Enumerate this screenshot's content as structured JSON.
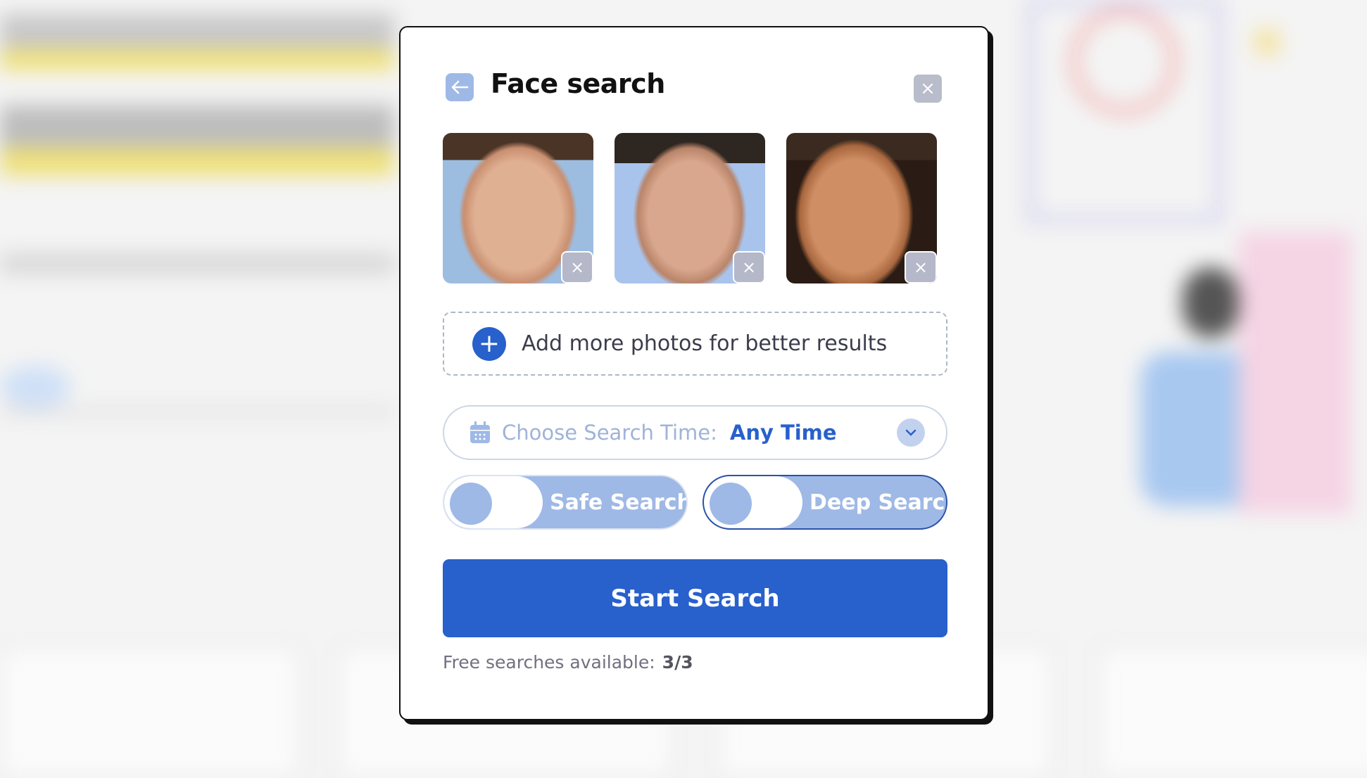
{
  "modal": {
    "title": "Face search",
    "back_icon": "arrow-left-icon",
    "close_label": "×",
    "photos": [
      {
        "remove_label": "×",
        "tone": [
          "#d9a98a",
          "#9cbde0"
        ]
      },
      {
        "remove_label": "×",
        "tone": [
          "#d6a48a",
          "#a9c4ec"
        ]
      },
      {
        "remove_label": "×",
        "tone": [
          "#c9855c",
          "#3a2a20"
        ]
      }
    ],
    "add_more": {
      "icon": "plus-icon",
      "label": "Add more photos for better results"
    },
    "search_time": {
      "icon": "calendar-icon",
      "label": "Choose Search Time:",
      "value": "Any Time"
    },
    "toggles": [
      {
        "label": "Safe Search",
        "on": false
      },
      {
        "label": "Deep Search",
        "on": false
      }
    ],
    "start_label": "Start Search",
    "free_searches": {
      "label": "Free searches available:",
      "value": "3/3"
    }
  },
  "colors": {
    "accent": "#2860cc",
    "toggle": "#9fb9e6"
  }
}
